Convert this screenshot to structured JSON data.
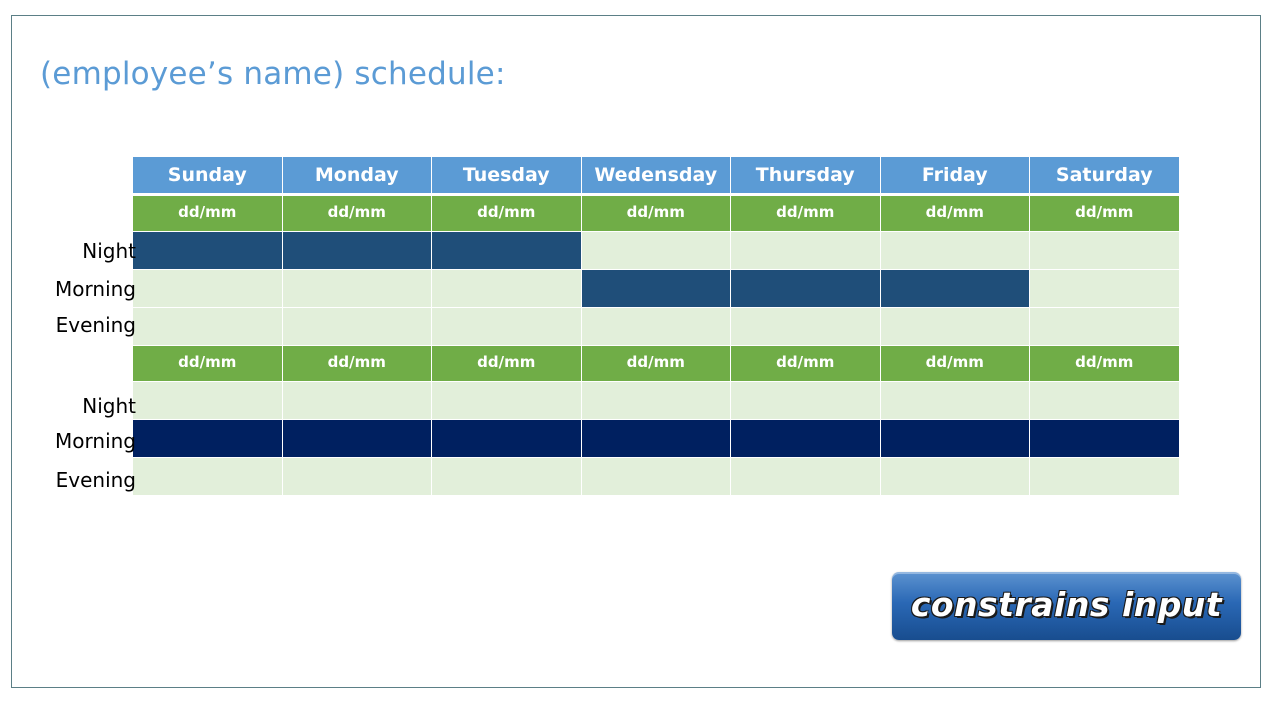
{
  "title": "(employee’s name) schedule:",
  "days": [
    "Sunday",
    "Monday",
    "Tuesday",
    "Wedensday",
    "Thursday",
    "Friday",
    "Saturday"
  ],
  "weeks": [
    {
      "dates": [
        "dd/mm",
        "dd/mm",
        "dd/mm",
        "dd/mm",
        "dd/mm",
        "dd/mm",
        "dd/mm"
      ],
      "shifts": [
        {
          "label": "Night",
          "on": [
            true,
            true,
            true,
            false,
            false,
            false,
            false
          ],
          "color": "#1f4e79"
        },
        {
          "label": "Morning",
          "on": [
            false,
            false,
            false,
            true,
            true,
            true,
            false
          ],
          "color": "#1f4e79"
        },
        {
          "label": "Evening",
          "on": [
            false,
            false,
            false,
            false,
            false,
            false,
            false
          ],
          "color": "#1f4e79"
        }
      ]
    },
    {
      "dates": [
        "dd/mm",
        "dd/mm",
        "dd/mm",
        "dd/mm",
        "dd/mm",
        "dd/mm",
        "dd/mm"
      ],
      "shifts": [
        {
          "label": "Night",
          "on": [
            false,
            false,
            false,
            false,
            false,
            false,
            false
          ],
          "color": "#002060"
        },
        {
          "label": "Morning",
          "on": [
            true,
            true,
            true,
            true,
            true,
            true,
            true
          ],
          "color": "#002060"
        },
        {
          "label": "Evening",
          "on": [
            false,
            false,
            false,
            false,
            false,
            false,
            false
          ],
          "color": "#002060"
        }
      ]
    }
  ],
  "colors": {
    "day_header": "#5b9bd5",
    "date_header": "#70ad47",
    "empty_cell": "#e2efda",
    "title": "#5b9bd5"
  },
  "button": {
    "label": "constrains input"
  }
}
